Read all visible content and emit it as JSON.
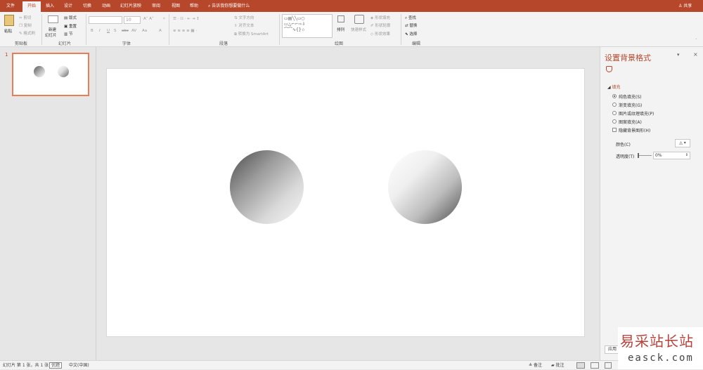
{
  "tabs": [
    {
      "label": "文件",
      "active": false
    },
    {
      "label": "开始",
      "active": true
    },
    {
      "label": "插入",
      "active": false
    },
    {
      "label": "设计",
      "active": false
    },
    {
      "label": "切换",
      "active": false
    },
    {
      "label": "动画",
      "active": false
    },
    {
      "label": "幻灯片放映",
      "active": false
    },
    {
      "label": "审阅",
      "active": false
    },
    {
      "label": "视图",
      "active": false
    },
    {
      "label": "帮助",
      "active": false
    }
  ],
  "tell_me": "告诉我你想要做什么",
  "share": "共享",
  "ribbon": {
    "clipboard": {
      "paste": "粘贴",
      "cut": "剪切",
      "copy": "复制",
      "format_painter": "格式刷",
      "label": "剪贴板"
    },
    "slides": {
      "new_slide_1": "新建",
      "new_slide_2": "幻灯片",
      "layout": "版式",
      "reset": "重置",
      "section": "节",
      "label": "幻灯片"
    },
    "font": {
      "size": "10",
      "label": "字体",
      "buttons": [
        "B",
        "I",
        "U",
        "S",
        "abc",
        "AV",
        "Aa",
        "A"
      ]
    },
    "paragraph": {
      "text_direction": "文字方向",
      "align_text": "对齐文本",
      "smartart": "转换为 SmartArt",
      "label": "段落"
    },
    "drawing": {
      "arrange": "排列",
      "quick_styles": "快速样式",
      "shape_fill": "形状填充",
      "shape_outline": "形状轮廓",
      "shape_effects": "形状效果",
      "label": "绘图"
    },
    "editing": {
      "find": "查找",
      "replace": "替换",
      "select": "选择",
      "label": "编辑"
    }
  },
  "slide_number": "1",
  "pane": {
    "title": "设置背景格式",
    "section": "填充",
    "options": [
      {
        "label": "纯色填充(S)",
        "selected": true
      },
      {
        "label": "渐变填充(G)",
        "selected": false
      },
      {
        "label": "图片或纹理填充(P)",
        "selected": false
      },
      {
        "label": "图案填充(A)",
        "selected": false
      }
    ],
    "hide_bg": "隐藏背景图形(H)",
    "color_label": "颜色(C)",
    "transparency_label": "透明度(T)",
    "transparency_value": "0%",
    "apply_button": "应用"
  },
  "status": {
    "slide_info": "幻灯片 第 1 张，共 1 张",
    "accessibility": "优题",
    "language": "中文(中国)",
    "notes": "备注",
    "comments": "批注"
  },
  "watermark": {
    "title": "易采站长站",
    "url": "easck.com"
  }
}
